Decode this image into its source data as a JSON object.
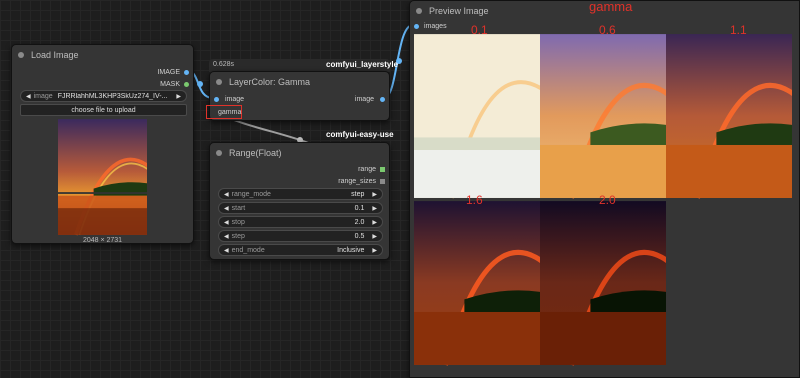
{
  "load_image": {
    "title": "Load Image",
    "out_image": "IMAGE",
    "out_mask": "MASK",
    "image_widget_label": "image",
    "image_widget_value": "FJRRlahhML3KHP3SkUz274_IV-...",
    "upload_label": "choose file to upload",
    "dims": "2048 × 2731"
  },
  "layercolor": {
    "timing": "0.628s",
    "group": "comfyui_layerstyle",
    "title": "LayerColor: Gamma",
    "in_image": "image",
    "out_image": "image",
    "in_gamma": "gamma"
  },
  "range": {
    "group": "comfyui-easy-use",
    "title": "Range(Float)",
    "out_range": "range",
    "out_range_sizes": "range_sizes",
    "widgets": [
      {
        "label": "range_mode",
        "value": "step"
      },
      {
        "label": "start",
        "value": "0.1"
      },
      {
        "label": "stop",
        "value": "2.0"
      },
      {
        "label": "step",
        "value": "0.5"
      },
      {
        "label": "end_mode",
        "value": "Inclusive"
      }
    ]
  },
  "preview": {
    "title": "Preview Image",
    "in_images": "images",
    "annotation": "gamma",
    "gamma_labels": [
      "0.1",
      "0.6",
      "1.1",
      "1.6",
      "2.0"
    ]
  },
  "colors": {
    "node_bg": "#353535",
    "canvas_bg": "#1e1e1e",
    "link_blue": "#64b5f6",
    "link_gray": "#9e9e9e",
    "accent_red": "#e0322a",
    "port_green": "#7bc96f"
  }
}
